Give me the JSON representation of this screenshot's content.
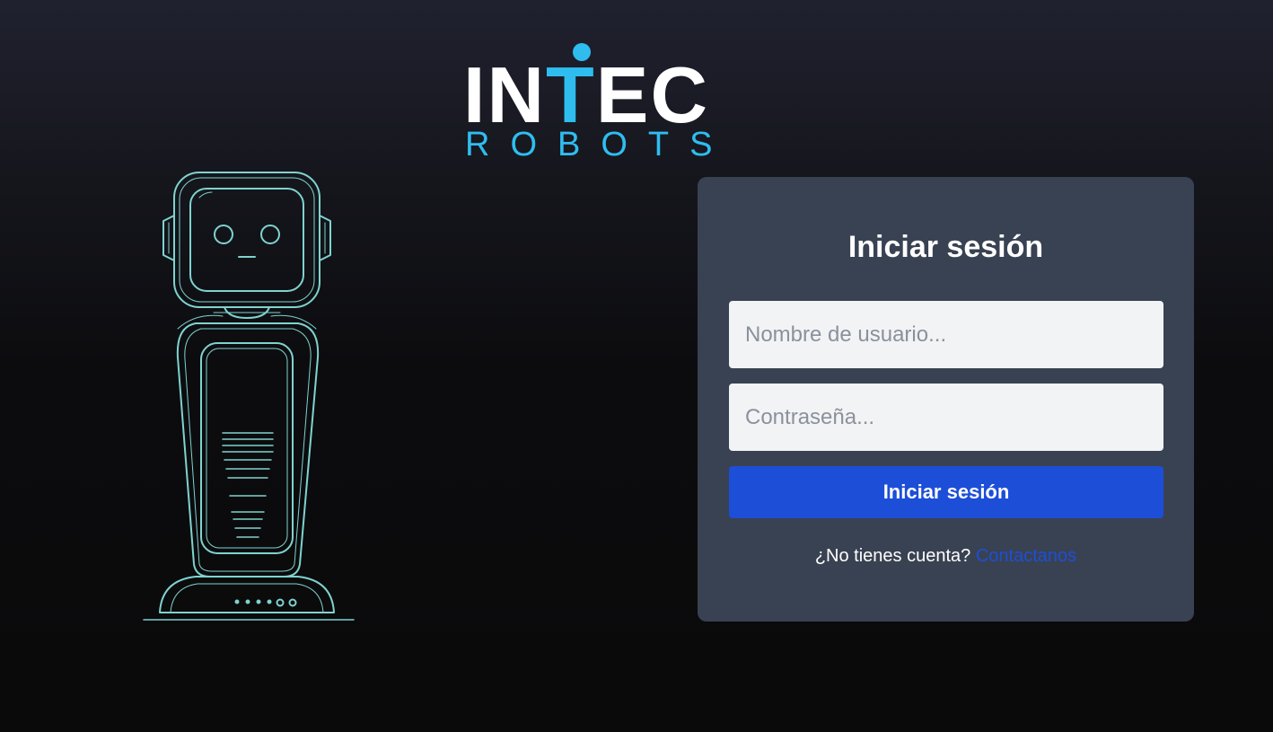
{
  "brand": {
    "logo_part1": "IN",
    "logo_accent": "T",
    "logo_part2": "EC",
    "logo_sub": "ROBOTS",
    "primary_color": "#ffffff",
    "accent_color": "#2fbdf0"
  },
  "illustration": {
    "icon": "robot-illustration",
    "stroke_color": "#7fd3cf"
  },
  "login": {
    "title": "Iniciar sesión",
    "username_placeholder": "Nombre de usuario...",
    "username_value": "",
    "password_placeholder": "Contraseña...",
    "password_value": "",
    "submit_label": "Iniciar sesión",
    "signup_prompt": "¿No tienes cuenta?",
    "signup_link": "Contactanos",
    "card_color": "#394252",
    "button_color": "#1d4ed8"
  }
}
